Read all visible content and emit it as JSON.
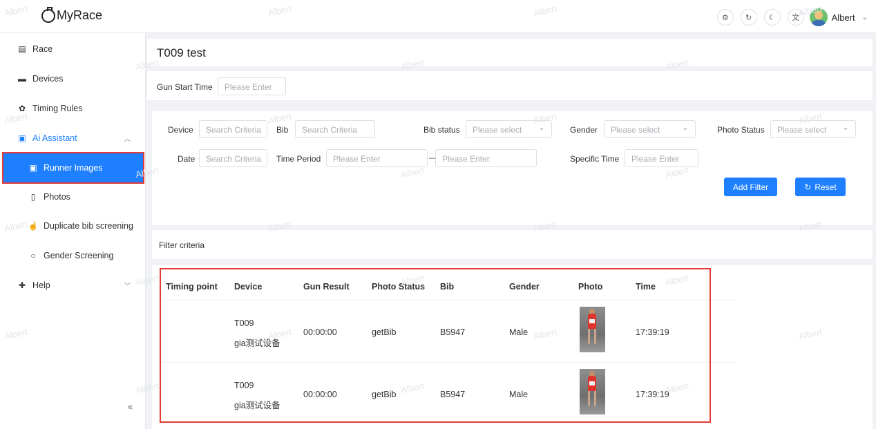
{
  "app": {
    "logo_text": "MyRace"
  },
  "header": {
    "icons": [
      "settings-icon",
      "refresh-icon",
      "moon-icon",
      "translate-icon"
    ],
    "user_name": "Albert"
  },
  "sidebar": {
    "items": [
      {
        "label": "Race",
        "icon": "clipboard-icon"
      },
      {
        "label": "Devices",
        "icon": "monitor-icon"
      },
      {
        "label": "Timing Rules",
        "icon": "gear-icon"
      },
      {
        "label": "Ai Assistant",
        "icon": "image-icon"
      },
      {
        "label": "Runner Images",
        "icon": "image-icon"
      },
      {
        "label": "Photos",
        "icon": "tablet-icon"
      },
      {
        "label": "Duplicate bib screening",
        "icon": "pointer-icon"
      },
      {
        "label": "Gender Screening",
        "icon": "search-icon"
      },
      {
        "label": "Help",
        "icon": "help-icon"
      }
    ],
    "collapse_glyph": "«"
  },
  "main": {
    "title": "T009 test",
    "gun_start": {
      "label": "Gun Start Time",
      "placeholder": "Please Enter"
    },
    "filters": {
      "device": {
        "label": "Device",
        "placeholder": "Search Criteria"
      },
      "bib": {
        "label": "Bib",
        "placeholder": "Search Criteria"
      },
      "bib_status": {
        "label": "Bib status",
        "placeholder": "Please select"
      },
      "gender": {
        "label": "Gender",
        "placeholder": "Please select"
      },
      "photo_status": {
        "label": "Photo Status",
        "placeholder": "Please select"
      },
      "date": {
        "label": "Date",
        "placeholder": "Search Criteria"
      },
      "time_period": {
        "label": "Time Period",
        "start_placeholder": "Please Enter",
        "separator": "—",
        "end_placeholder": "Please Enter"
      },
      "specific_time": {
        "label": "Specific Time",
        "placeholder": "Please Enter"
      },
      "add_filter_label": "Add Filter",
      "reset_label": "Reset"
    },
    "criteria_label": "Filter criteria",
    "table": {
      "columns": [
        "Timing point",
        "Device",
        "Gun Result",
        "Photo Status",
        "Bib",
        "Gender",
        "Photo",
        "Time"
      ],
      "rows": [
        {
          "timing_point": "",
          "device_line1": "T009",
          "device_line2": "gia测试设备",
          "gun_result": "00:00:00",
          "photo_status": "getBib",
          "bib": "B5947",
          "gender": "Male",
          "time": "17:39:19"
        },
        {
          "timing_point": "",
          "device_line1": "T009",
          "device_line2": "gia测试设备",
          "gun_result": "00:00:00",
          "photo_status": "getBib",
          "bib": "B5947",
          "gender": "Male",
          "time": "17:39:19"
        }
      ]
    }
  },
  "watermark": "Albert"
}
